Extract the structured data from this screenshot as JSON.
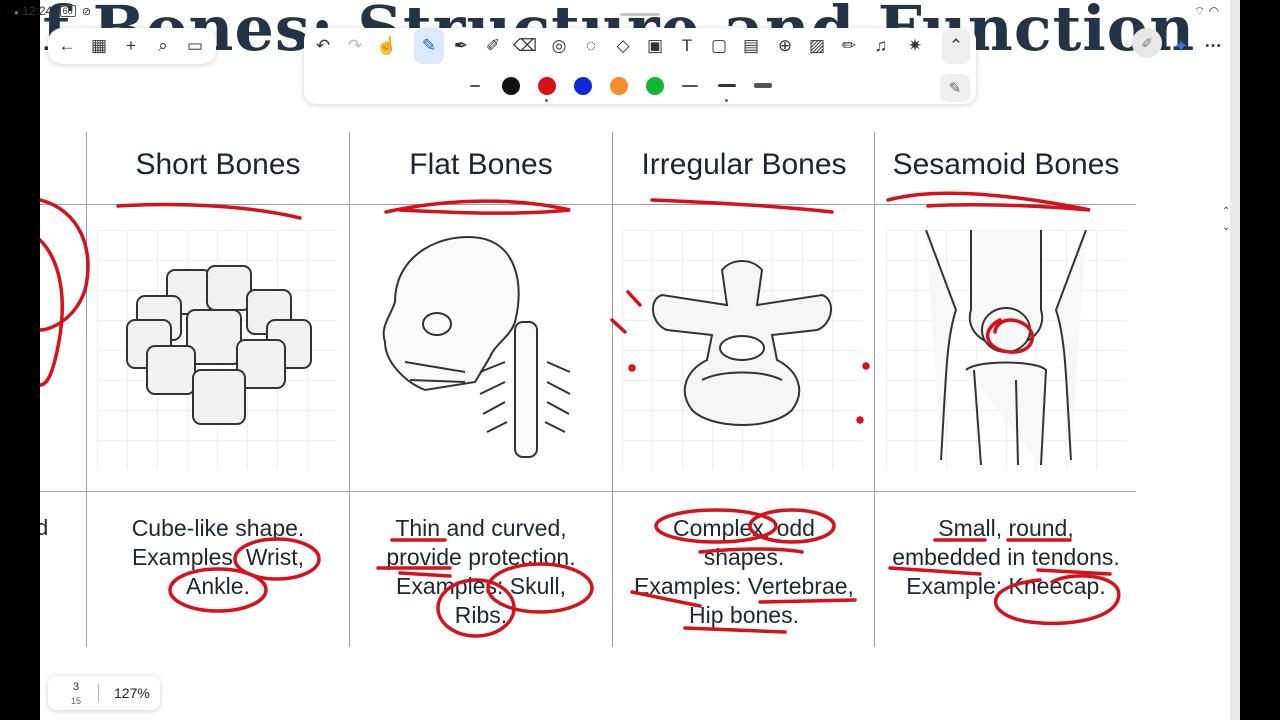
{
  "status_bar": {
    "time": "12:24",
    "battery": "66"
  },
  "document": {
    "title_fragment": "of Bones: Structure and Function",
    "columns": [
      {
        "heading": "Short Bones",
        "description": [
          "Cube-like shape.",
          "Examples: Wrist,",
          "Ankle."
        ]
      },
      {
        "heading": "Flat Bones",
        "description": [
          "Thin and curved,",
          "provide protection.",
          "Examples: Skull,",
          "Ribs."
        ]
      },
      {
        "heading": "Irregular Bones",
        "description": [
          "Complex, odd",
          "shapes.",
          "Examples: Vertebrae,",
          "Hip bones."
        ]
      },
      {
        "heading": "Sesamoid Bones",
        "description": [
          "Small, round,",
          "embedded in tendons.",
          "Example: Kneecap."
        ]
      }
    ],
    "partial_left_text": "d"
  },
  "toolbar": {
    "left_tools": [
      "back-icon",
      "grid-icon",
      "plus-icon",
      "search-icon",
      "layers-icon"
    ],
    "main_tools": [
      "undo-icon",
      "redo-icon",
      "touch-pen-icon",
      "pen-icon",
      "fountain-pen-icon",
      "highlighter-icon",
      "eraser-icon",
      "lasso-icon",
      "speech-bubble-icon",
      "shapes-icon",
      "image-icon",
      "text-icon",
      "sticky-note-icon",
      "table-icon",
      "zoom-icon",
      "chart-icon",
      "ruler-icon",
      "microphone-icon",
      "magic-wand-icon",
      "collapse-icon"
    ],
    "pen_colors": [
      "#111111",
      "#d8101a",
      "#1029d6",
      "#f78c2b",
      "#12b534"
    ],
    "selected_color_index": 1
  },
  "page_indicator": {
    "current": "3",
    "total": "15",
    "zoom": "127%"
  }
}
